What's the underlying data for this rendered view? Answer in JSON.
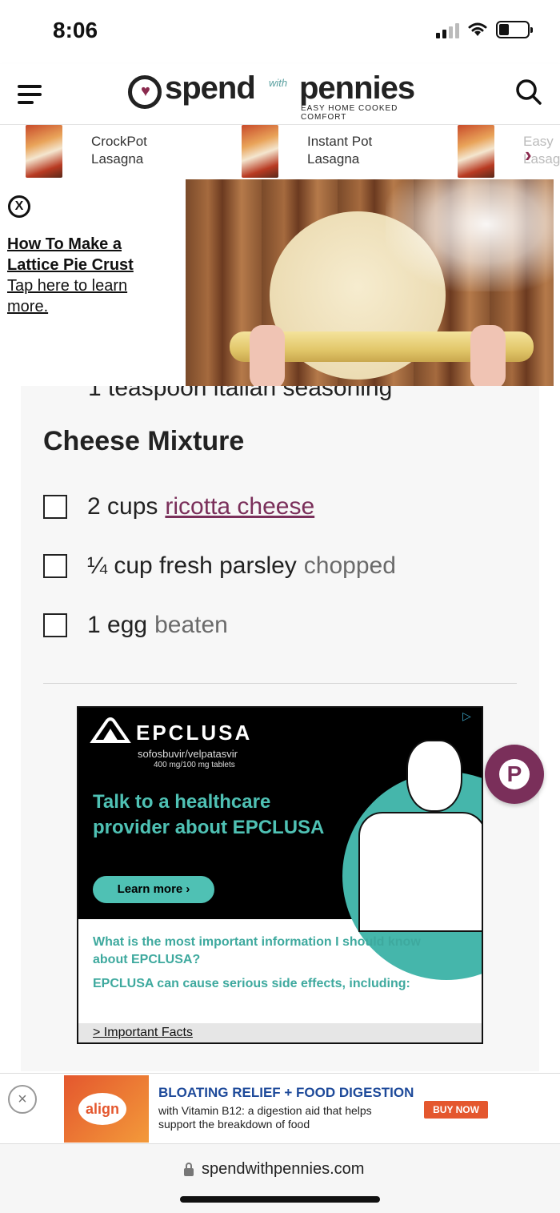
{
  "status": {
    "time": "8:06"
  },
  "header": {
    "logo_word1": "spend",
    "logo_with": "with",
    "logo_word2": "pennies",
    "logo_tagline": "EASY HOME COOKED COMFORT"
  },
  "related": [
    {
      "label_line1": "CrockPot",
      "label_line2": "Lasagna"
    },
    {
      "label_line1": "Instant Pot",
      "label_line2": "Lasagna"
    },
    {
      "label_line1": "Easy",
      "label_line2": "Lasag"
    }
  ],
  "video": {
    "close": "X",
    "title": "How To Make a Lattice Pie Crust",
    "subtitle": "Tap here to learn more."
  },
  "recipe": {
    "partial_row": "1 teaspoon italian seasoning",
    "section_title": "Cheese Mixture",
    "ingredients": [
      {
        "text": "2 cups",
        "link": "ricotta cheese",
        "note": ""
      },
      {
        "text": "¼ cup fresh parsley",
        "link": "",
        "note": "chopped"
      },
      {
        "text": "1 egg",
        "link": "",
        "note": "beaten"
      }
    ]
  },
  "ad": {
    "brand": "EPCLUSA",
    "generic": "sofosbuvir/velpatasvir",
    "dose": "400 mg/100 mg tablets",
    "headline": "Talk to a healthcare provider about EPCLUSA",
    "cta": "Learn more ›",
    "question": "What is the most important information I should know about EPCLUSA?",
    "warning": "EPCLUSA can cause serious side effects, including:",
    "facts_link": "> Important Facts",
    "accent": "#4fc1b4"
  },
  "bottom_ad": {
    "close": "×",
    "logo": "align",
    "headline": "BLOATING RELIEF + FOOD DIGESTION",
    "sub": "with Vitamin B12: a digestion aid that helps support the breakdown of food",
    "cta": "BUY NOW"
  },
  "urlbar": {
    "url": "spendwithpennies.com"
  },
  "colors": {
    "brand": "#7a2f5a",
    "link": "#7a2f5a"
  }
}
